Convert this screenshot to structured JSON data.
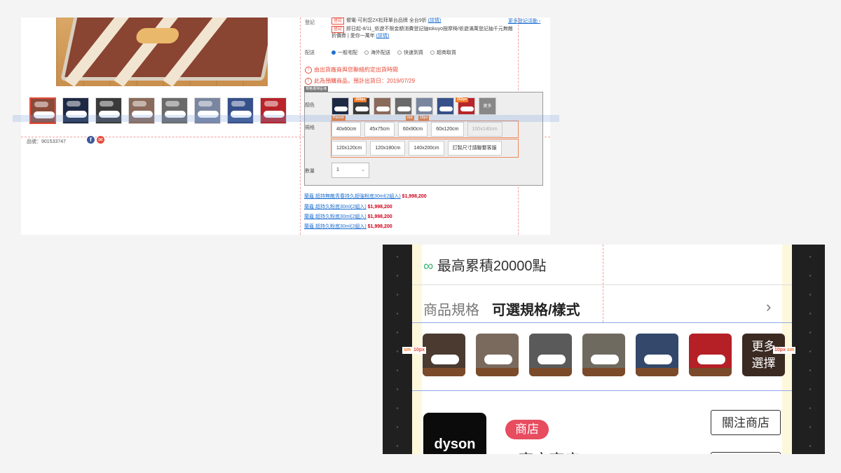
{
  "desktop": {
    "sku": "品號：901533747",
    "labels": {
      "register": "登記",
      "shipping": "配送",
      "color": "顏色",
      "size": "規格",
      "quantity": "數量"
    },
    "promos": [
      {
        "tag": "登記",
        "text": "嚮電-可利您2X松拜單台品牌 全台9折",
        "link": "(詳情)"
      },
      {
        "tag": "登記",
        "text": "即日起-8/11_依遊不限金額消費登記抽tokuyo按摩椅/依遊滿萬登記抽千元無敵折價券 | 愛你一萬年",
        "link": "(詳情)"
      }
    ],
    "more_events": "更多登記活動 ›",
    "shipping_options": [
      "一般宅配",
      "海外配送",
      "快速到貨",
      "超商取貨"
    ],
    "notices": [
      "由出貨廠商與您聯絡約定出貨時間",
      "此為預購商品，預計出貨日：2019/07/29"
    ],
    "spec_title": "規格選擇區塊",
    "color_more": "更多",
    "sizes_row1": [
      "40x60cm",
      "45x75cm",
      "60x90cm",
      "60x120cm",
      "100x140cm"
    ],
    "sizes_row2": [
      "120x120cm",
      "120x180cm",
      "140x200cm",
      "訂製尺寸請聯繫客服"
    ],
    "quantity_value": "1",
    "measure_labels": {
      "w150": "150px",
      "w252": "252px",
      "parent": "Parent",
      "md": "md",
      "g15": "15px"
    },
    "related": [
      {
        "name": "蘭蔻 超持無敵青春持久超強粉底30ml(2組入)",
        "price": "$1,998,200"
      },
      {
        "name": "蘭蔻 超持久粉底30ml(2組入)",
        "price": "$1,998,200"
      },
      {
        "name": "蘭蔻 超持久粉底30ml(2組入)",
        "price": "$1,998,200"
      },
      {
        "name": "蘭蔻 超持久粉底30ml(2組入)",
        "price": "$1,998,200"
      }
    ],
    "thumb_colors": [
      "#8a4a3a",
      "#1e2a44",
      "#3a3a3a",
      "#8a6a5a",
      "#6a6a6a",
      "#7a86a0",
      "#36508a",
      "#b8242a"
    ]
  },
  "mobile": {
    "points": "最高累積20000點",
    "spec_label": "商品規格",
    "spec_value": "可選規格/樣式",
    "more_choice": "更多選擇",
    "shop_badge": "商店",
    "follow": "關注商店",
    "brand": "dyson",
    "shop_name_partial": "d     官方商店",
    "tags": {
      "sm": "sm",
      "p10": "10px"
    },
    "thumb_colors": [
      "#4a3a30",
      "#7a6a5e",
      "#5a5a5a",
      "#6f6a60",
      "#33486a",
      "#b51f26"
    ]
  },
  "colors": {
    "accent_red": "#e74c3c",
    "link_blue": "#1d6fd1",
    "price_red": "#d0021b",
    "shop_pink": "#e84c5f"
  }
}
